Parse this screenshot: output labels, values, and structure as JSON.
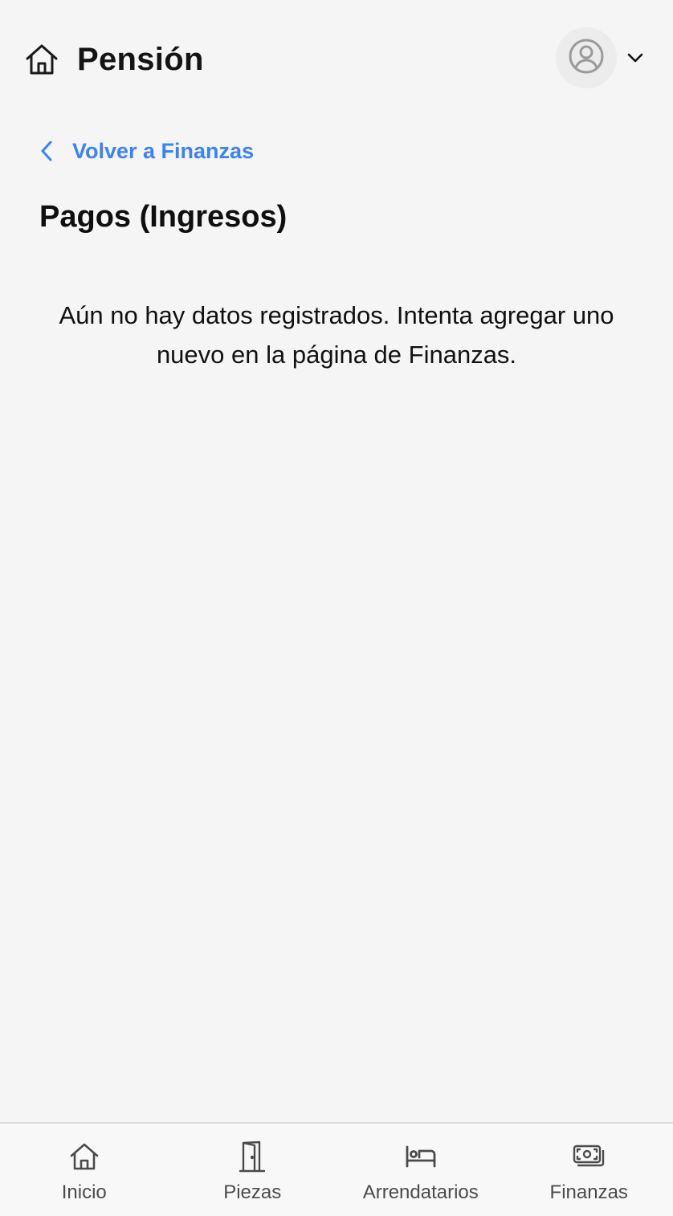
{
  "header": {
    "title": "Pensión",
    "home_icon": "home-icon",
    "avatar_icon": "user-circle-icon",
    "dropdown_icon": "chevron-down-icon"
  },
  "back_link": {
    "label": "Volver a Finanzas",
    "icon": "chevron-left-icon",
    "color": "#3b82f6"
  },
  "main": {
    "title": "Pagos (Ingresos)",
    "empty_message": "Aún no hay datos registrados. Intenta agregar uno nuevo en la página de Finanzas."
  },
  "bottom_nav": {
    "items": [
      {
        "label": "Inicio",
        "icon": "home-icon"
      },
      {
        "label": "Piezas",
        "icon": "door-icon"
      },
      {
        "label": "Arrendatarios",
        "icon": "bed-icon"
      },
      {
        "label": "Finanzas",
        "icon": "cash-icon"
      }
    ]
  }
}
